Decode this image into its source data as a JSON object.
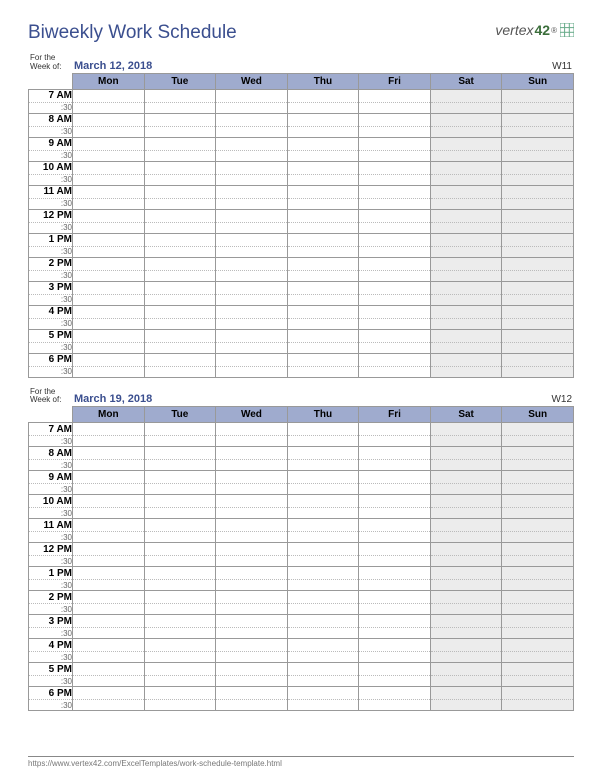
{
  "title": "Biweekly Work Schedule",
  "logo_text": "vertex",
  "logo_num": "42",
  "days": [
    "Mon",
    "Tue",
    "Wed",
    "Thu",
    "Fri",
    "Sat",
    "Sun"
  ],
  "weekend_cols": [
    5,
    6
  ],
  "hours": [
    "7 AM",
    "8 AM",
    "9 AM",
    "10 AM",
    "11 AM",
    "12 PM",
    "1 PM",
    "2 PM",
    "3 PM",
    "4 PM",
    "5 PM",
    "6 PM"
  ],
  "half_label": ":30",
  "for_week_label": "For the Week of:",
  "weeks": [
    {
      "date": "March 12, 2018",
      "week_number": "W11"
    },
    {
      "date": "March 19, 2018",
      "week_number": "W12"
    }
  ],
  "footer_url": "https://www.vertex42.com/ExcelTemplates/work-schedule-template.html"
}
